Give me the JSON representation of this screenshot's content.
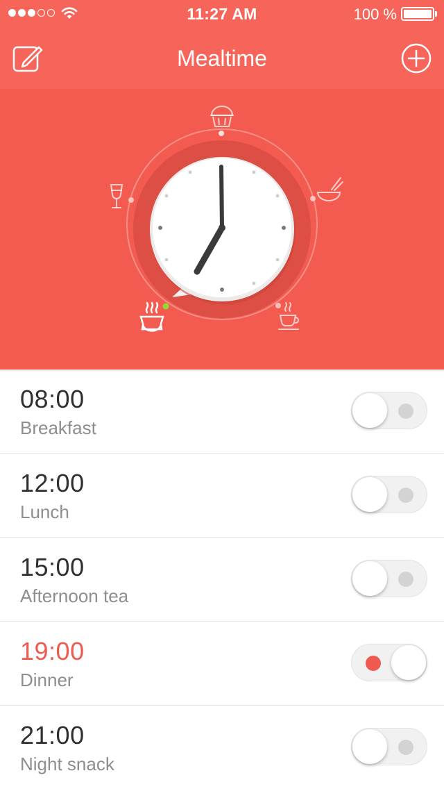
{
  "status_bar": {
    "signal_dots_filled": 3,
    "signal_dots_total": 5,
    "time": "11:27 AM",
    "battery_percent": "100 %"
  },
  "nav": {
    "title": "Mealtime",
    "left_icon": "edit-icon",
    "right_icon": "add-circle-icon"
  },
  "clock": {
    "hour": 7,
    "minute": 0,
    "meal_icons": [
      "cupcake-icon",
      "soup-bowl-icon",
      "coffee-cup-icon",
      "rice-bowl-icon",
      "wine-glass-icon"
    ]
  },
  "alarms": [
    {
      "time": "08:00",
      "label": "Breakfast",
      "enabled": false
    },
    {
      "time": "12:00",
      "label": "Lunch",
      "enabled": false
    },
    {
      "time": "15:00",
      "label": "Afternoon tea",
      "enabled": false
    },
    {
      "time": "19:00",
      "label": "Dinner",
      "enabled": true
    },
    {
      "time": "21:00",
      "label": "Night snack",
      "enabled": false
    }
  ],
  "colors": {
    "accent": "#ef5a50",
    "nav_background": "#f7655a",
    "hero_background": "#f45b50"
  }
}
